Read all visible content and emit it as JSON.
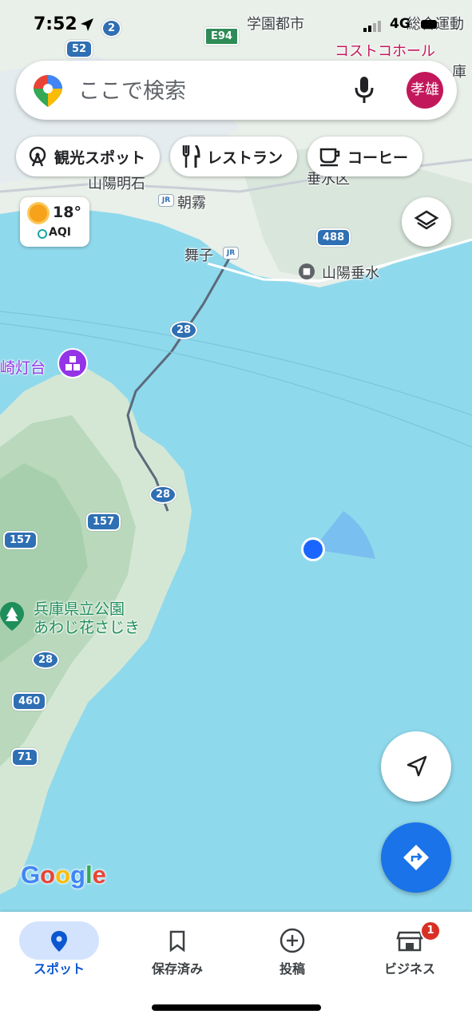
{
  "status_bar": {
    "time": "7:52",
    "network": "4G"
  },
  "search": {
    "placeholder": "ここで検索",
    "avatar_initials": "孝雄"
  },
  "chips": [
    {
      "label": "観光スポット",
      "icon": "ferris-wheel-icon"
    },
    {
      "label": "レストラン",
      "icon": "fork-knife-icon"
    },
    {
      "label": "コーヒー",
      "icon": "coffee-cup-icon"
    }
  ],
  "weather": {
    "temperature": "18°",
    "aqi_label": "AQI",
    "icon": "sun-icon"
  },
  "map": {
    "places": {
      "gakuen": "学園都市",
      "sogo": "総合運動",
      "costco": "コストコホール",
      "tarumi_ku": "垂水区",
      "sanyo_akashi": "山陽明石",
      "asagiri": "朝霧",
      "maiko": "舞子",
      "sanyo_tarumi": "山陽垂水",
      "lighthouse": "崎灯台",
      "park_line1": "兵庫県立公園",
      "park_line2": "あわじ花さじき",
      "edge_char": "庫"
    },
    "routes": {
      "e94": "E94",
      "r2": "2",
      "r52": "52",
      "r488": "488",
      "r28a": "28",
      "r28b": "28",
      "r28c": "28",
      "r157a": "157",
      "r157b": "157",
      "r460": "460",
      "r71": "71"
    },
    "attribution": "Google"
  },
  "colors": {
    "accent": "#1a73e8",
    "water": "#8fd9ec",
    "land": "#e9f1ea",
    "badge": "#d93025"
  },
  "nav": {
    "tabs": [
      {
        "label": "スポット",
        "icon": "pin-icon",
        "active": true
      },
      {
        "label": "保存済み",
        "icon": "bookmark-icon",
        "active": false
      },
      {
        "label": "投稿",
        "icon": "add-circle-icon",
        "active": false
      },
      {
        "label": "ビジネス",
        "icon": "store-icon",
        "active": false,
        "badge": "1"
      }
    ]
  }
}
